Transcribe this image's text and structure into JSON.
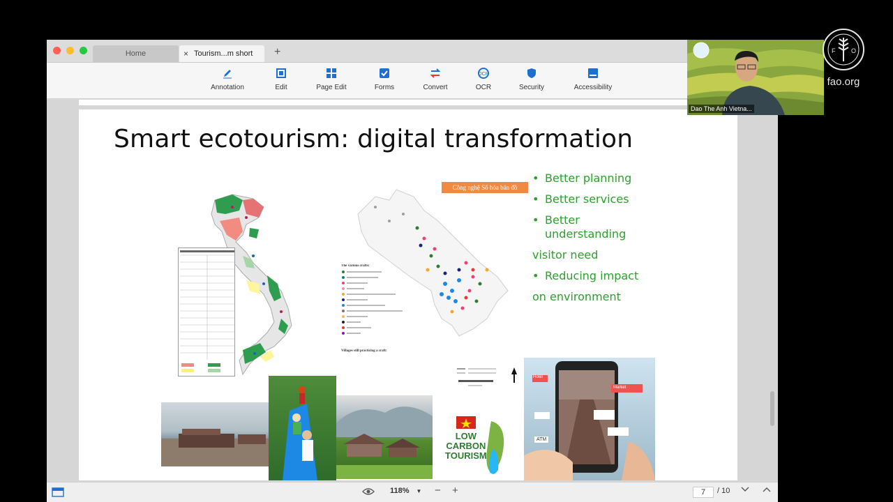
{
  "window": {
    "tabs": [
      {
        "label": "Home"
      },
      {
        "label": "Tourism...m short"
      }
    ],
    "new_tab": "+",
    "close_tab": "×"
  },
  "toolbar": {
    "items": [
      {
        "label": "Annotation",
        "icon": "pen-icon"
      },
      {
        "label": "Edit",
        "icon": "edit-icon"
      },
      {
        "label": "Page Edit",
        "icon": "page-edit-icon"
      },
      {
        "label": "Forms",
        "icon": "forms-icon"
      },
      {
        "label": "Convert",
        "icon": "convert-icon"
      },
      {
        "label": "OCR",
        "icon": "ocr-icon"
      },
      {
        "label": "Security",
        "icon": "shield-icon"
      },
      {
        "label": "Accessibility",
        "icon": "accessibility-icon"
      }
    ],
    "accent": "#1f6fd1"
  },
  "slide": {
    "title": "Smart ecotourism: digital transformation",
    "bullets": [
      {
        "text": "Better planning",
        "bullet": true
      },
      {
        "text": "Better services",
        "bullet": true
      },
      {
        "text": "Better understanding",
        "bullet": true
      },
      {
        "text": "visitor need",
        "bullet": false
      },
      {
        "text": "Reducing impact",
        "bullet": true
      },
      {
        "text": "on environment",
        "bullet": false
      }
    ],
    "bullet_color": "#2ca02c",
    "map_tag": "Công nghệ  Số hóa bản đồ",
    "map_legend_title": "The various crafts:",
    "map_legend_note": "Villages still practicing a craft:",
    "low_carbon": [
      "LOW",
      "CARBON",
      "TOURISM"
    ],
    "ar_labels": [
      "ATM",
      "Hotel",
      "Market"
    ]
  },
  "statusbar": {
    "zoom": "118%",
    "page_current": "7",
    "page_total": "/ 10",
    "zoom_out": "−",
    "zoom_in": "+"
  },
  "video": {
    "speaker_name": "Dao The Anh Vietna..."
  },
  "watermark": {
    "site": "fao.org"
  }
}
